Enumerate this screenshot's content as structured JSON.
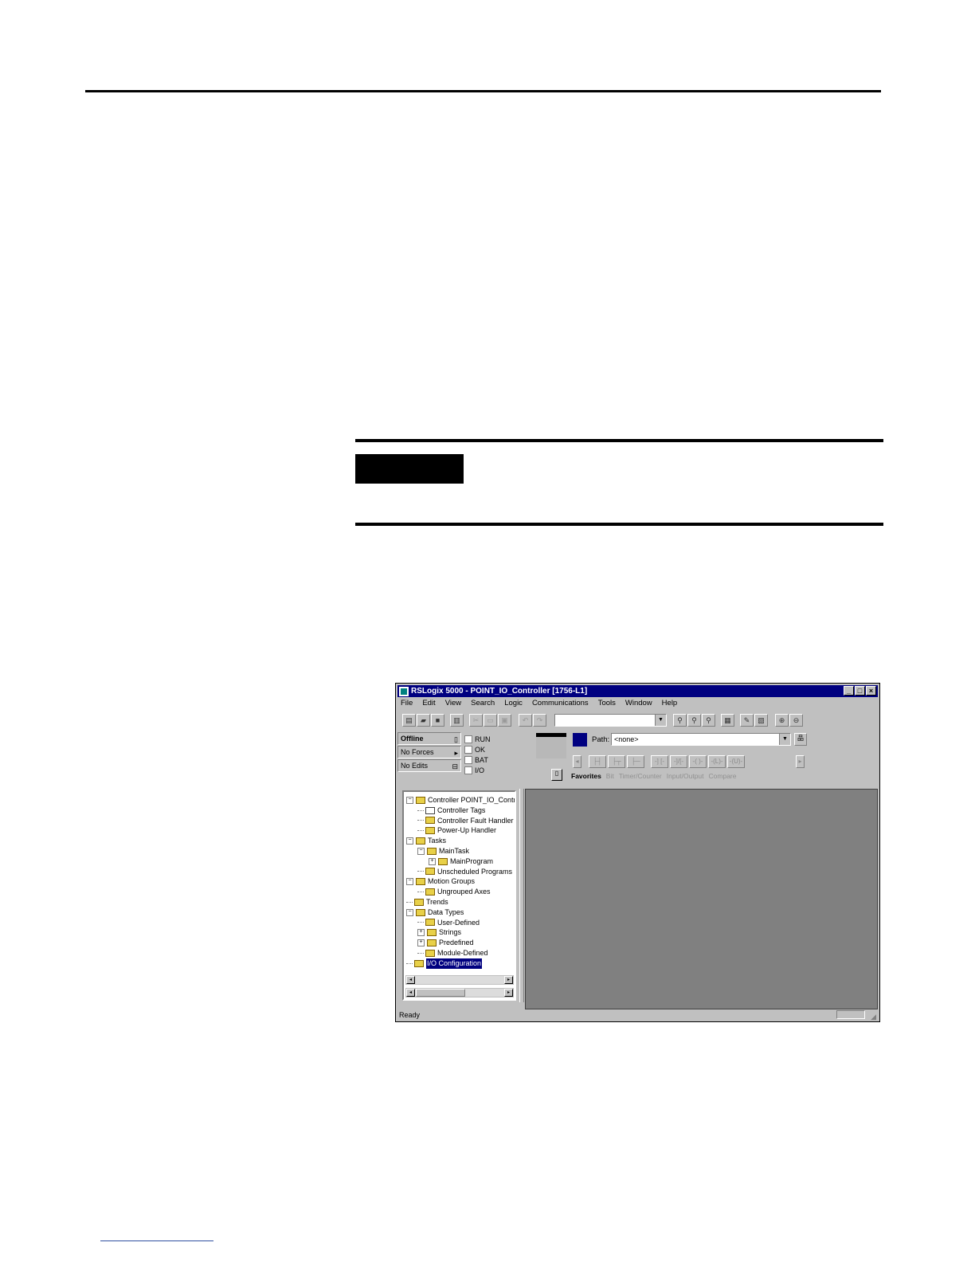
{
  "window": {
    "title": "RSLogix 5000 - POINT_IO_Controller [1756-L1]",
    "controls": {
      "minimize": "_",
      "maximize": "□",
      "close": "×"
    }
  },
  "menu": [
    "File",
    "Edit",
    "View",
    "Search",
    "Logic",
    "Communications",
    "Tools",
    "Window",
    "Help"
  ],
  "toolbar": {
    "icons": [
      "new-icon",
      "open-icon",
      "save-icon",
      "print-icon",
      "cut-icon",
      "copy-icon",
      "paste-icon",
      "undo-icon",
      "redo-icon",
      "find-icon",
      "find-next-icon",
      "find-prev-icon",
      "verify-icon",
      "edit-icon",
      "properties-icon",
      "zoom-in-icon",
      "zoom-out-icon"
    ],
    "search_value": ""
  },
  "status": {
    "mode": "Offline",
    "forces": "No Forces",
    "edits": "No Edits",
    "indicators": [
      "RUN",
      "OK",
      "BAT",
      "I/O"
    ]
  },
  "path": {
    "label": "Path:",
    "value": "<none>"
  },
  "instruction_tabs": [
    "Favorites",
    "Bit",
    "Timer/Counter",
    "Input/Output",
    "Compare"
  ],
  "tree": [
    {
      "label": "Controller POINT_IO_Contro",
      "level": 0,
      "expander": "−",
      "kind": "folder"
    },
    {
      "label": "Controller Tags",
      "level": 1,
      "expander": "",
      "kind": "tags"
    },
    {
      "label": "Controller Fault Handler",
      "level": 1,
      "expander": "",
      "kind": "folder"
    },
    {
      "label": "Power-Up Handler",
      "level": 1,
      "expander": "",
      "kind": "folder"
    },
    {
      "label": "Tasks",
      "level": 0,
      "expander": "−",
      "kind": "folder"
    },
    {
      "label": "MainTask",
      "level": 1,
      "expander": "−",
      "kind": "folder"
    },
    {
      "label": "MainProgram",
      "level": 2,
      "expander": "+",
      "kind": "folder"
    },
    {
      "label": "Unscheduled Programs",
      "level": 1,
      "expander": "",
      "kind": "folder"
    },
    {
      "label": "Motion Groups",
      "level": 0,
      "expander": "−",
      "kind": "folder"
    },
    {
      "label": "Ungrouped Axes",
      "level": 1,
      "expander": "",
      "kind": "folder"
    },
    {
      "label": "Trends",
      "level": 0,
      "expander": "",
      "kind": "folder"
    },
    {
      "label": "Data Types",
      "level": 0,
      "expander": "−",
      "kind": "folder"
    },
    {
      "label": "User-Defined",
      "level": 1,
      "expander": "",
      "kind": "folder"
    },
    {
      "label": "Strings",
      "level": 1,
      "expander": "+",
      "kind": "folder"
    },
    {
      "label": "Predefined",
      "level": 1,
      "expander": "+",
      "kind": "folder"
    },
    {
      "label": "Module-Defined",
      "level": 1,
      "expander": "",
      "kind": "folder"
    },
    {
      "label": "I/O Configuration",
      "level": 0,
      "expander": "",
      "kind": "folder",
      "selected": true
    }
  ],
  "statusbar": {
    "text": "Ready"
  }
}
